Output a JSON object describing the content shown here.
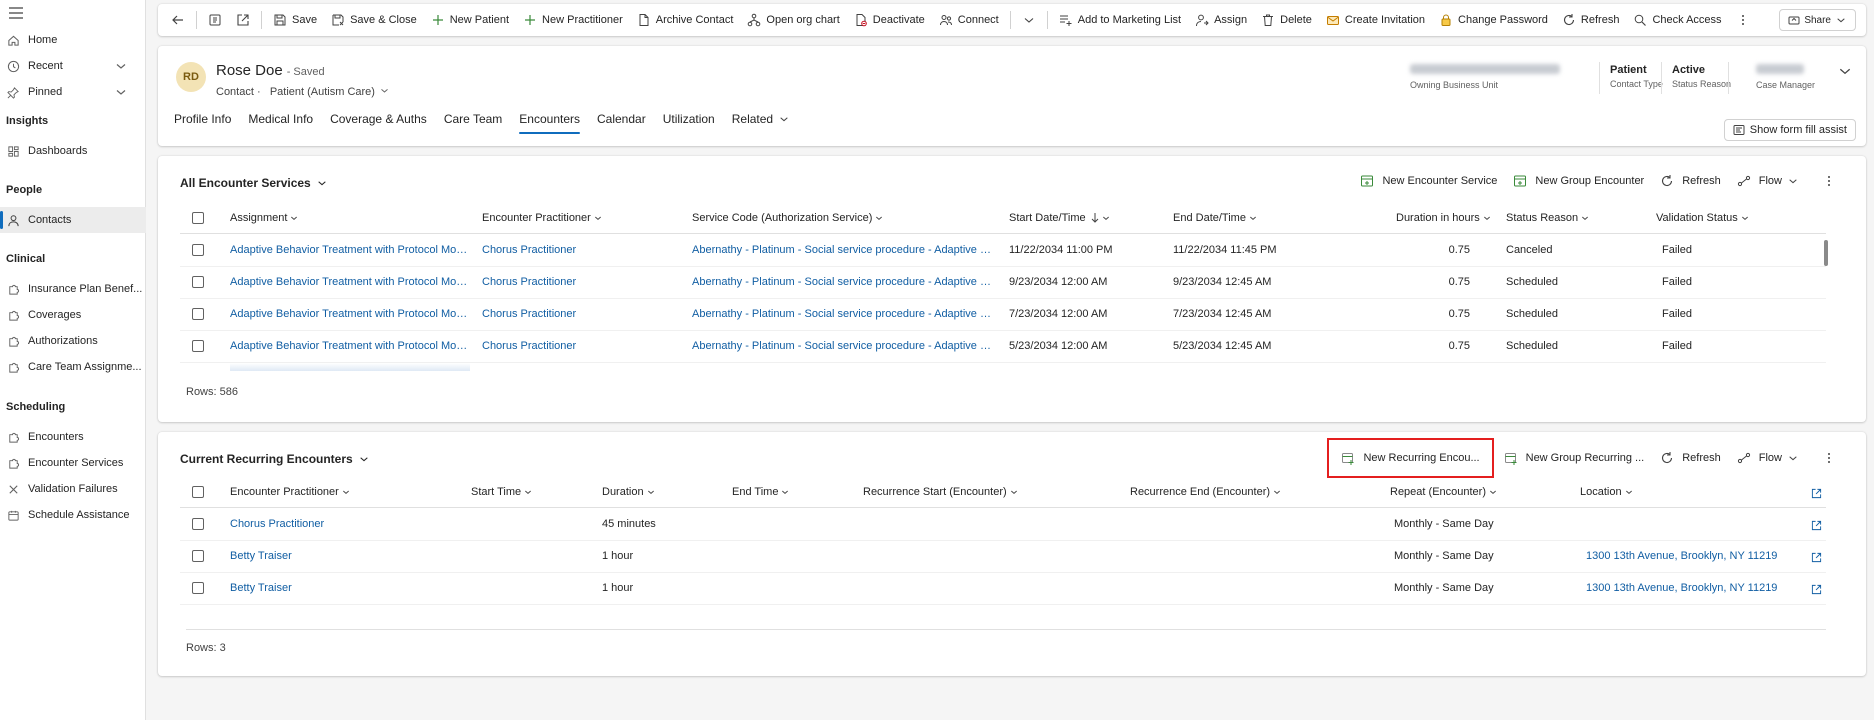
{
  "sidebar": {
    "items": [
      {
        "key": "home",
        "label": "Home",
        "icon": "home-icon"
      },
      {
        "key": "recent",
        "label": "Recent",
        "icon": "clock-icon"
      },
      {
        "key": "pinned",
        "label": "Pinned",
        "icon": "pin-icon"
      }
    ],
    "groups": {
      "insights": "Insights",
      "people": "People",
      "clinical": "Clinical",
      "scheduling": "Scheduling"
    },
    "insights_items": [
      "Dashboards"
    ],
    "people_items": [
      "Contacts"
    ],
    "clinical_items": [
      "Insurance Plan Benef...",
      "Coverages",
      "Authorizations",
      "Care Team Assignme..."
    ],
    "scheduling_items": [
      "Encounters",
      "Encounter Services",
      "Validation Failures",
      "Schedule Assistance"
    ]
  },
  "commandbar": {
    "save": "Save",
    "save_close": "Save & Close",
    "new_patient": "New Patient",
    "new_practitioner": "New Practitioner",
    "archive_contact": "Archive Contact",
    "open_org_chart": "Open org chart",
    "deactivate": "Deactivate",
    "connect": "Connect",
    "add_marketing": "Add to Marketing List",
    "assign": "Assign",
    "delete": "Delete",
    "create_invitation": "Create Invitation",
    "change_password": "Change Password",
    "refresh": "Refresh",
    "check_access": "Check Access",
    "share": "Share"
  },
  "record": {
    "initials": "RD",
    "name": "Rose Doe",
    "saved": "- Saved",
    "entity": "Contact",
    "form": "Patient (Autism Care)",
    "owning_bu_label": "Owning Business Unit",
    "contact_type_value": "Patient",
    "contact_type_label": "Contact Type",
    "status_value": "Active",
    "status_label": "Status Reason",
    "case_manager_label": "Case Manager"
  },
  "tabs": [
    "Profile Info",
    "Medical Info",
    "Coverage & Auths",
    "Care Team",
    "Encounters",
    "Calendar",
    "Utilization",
    "Related"
  ],
  "form_fill_assist": "Show form fill assist",
  "encounter_services": {
    "title": "All Encounter Services",
    "cmd_new_service": "New Encounter Service",
    "cmd_new_group": "New Group Encounter",
    "cmd_refresh": "Refresh",
    "cmd_flow": "Flow",
    "columns": [
      "Assignment",
      "Encounter Practitioner",
      "Service Code (Authorization Service)",
      "Start Date/Time",
      "End Date/Time",
      "Duration in hours",
      "Status Reason",
      "Validation Status"
    ],
    "rows": [
      {
        "assignment": "Adaptive Behavior Treatment with Protocol Mod...",
        "practitioner": "Chorus Practitioner",
        "service": "Abernathy - Platinum - Social service procedure - Adaptive Be...",
        "start": "11/22/2034 11:00 PM",
        "end": "11/22/2034 11:45 PM",
        "duration": "0.75",
        "status": "Canceled",
        "validation": "Failed"
      },
      {
        "assignment": "Adaptive Behavior Treatment with Protocol Mod...",
        "practitioner": "Chorus Practitioner",
        "service": "Abernathy - Platinum - Social service procedure - Adaptive Be...",
        "start": "9/23/2034 12:00 AM",
        "end": "9/23/2034 12:45 AM",
        "duration": "0.75",
        "status": "Scheduled",
        "validation": "Failed"
      },
      {
        "assignment": "Adaptive Behavior Treatment with Protocol Mod...",
        "practitioner": "Chorus Practitioner",
        "service": "Abernathy - Platinum - Social service procedure - Adaptive Be...",
        "start": "7/23/2034 12:00 AM",
        "end": "7/23/2034 12:45 AM",
        "duration": "0.75",
        "status": "Scheduled",
        "validation": "Failed"
      },
      {
        "assignment": "Adaptive Behavior Treatment with Protocol Mod...",
        "practitioner": "Chorus Practitioner",
        "service": "Abernathy - Platinum - Social service procedure - Adaptive Be...",
        "start": "5/23/2034 12:00 AM",
        "end": "5/23/2034 12:45 AM",
        "duration": "0.75",
        "status": "Scheduled",
        "validation": "Failed"
      }
    ],
    "rows_label": "Rows: 586"
  },
  "recurring": {
    "title": "Current Recurring Encounters",
    "cmd_new_recurring": "New Recurring Encou...",
    "cmd_new_group_recurring": "New Group Recurring ...",
    "cmd_refresh": "Refresh",
    "cmd_flow": "Flow",
    "columns": [
      "Encounter Practitioner",
      "Start Time",
      "Duration",
      "End Time",
      "Recurrence Start (Encounter)",
      "Recurrence End (Encounter)",
      "Repeat (Encounter)",
      "Location"
    ],
    "rows": [
      {
        "practitioner": "Chorus Practitioner",
        "start": "",
        "duration": "45 minutes",
        "end": "",
        "rec_start": "",
        "rec_end": "",
        "repeat": "Monthly - Same Day",
        "location": ""
      },
      {
        "practitioner": "Betty Traiser",
        "start": "",
        "duration": "1 hour",
        "end": "",
        "rec_start": "",
        "rec_end": "",
        "repeat": "Monthly - Same Day",
        "location": "1300 13th Avenue, Brooklyn, NY 11219"
      },
      {
        "practitioner": "Betty Traiser",
        "start": "",
        "duration": "1 hour",
        "end": "",
        "rec_start": "",
        "rec_end": "",
        "repeat": "Monthly - Same Day",
        "location": "1300 13th Avenue, Brooklyn, NY 11219"
      }
    ],
    "rows_label": "Rows: 3"
  },
  "colors": {
    "accent": "#0f6cbd",
    "link": "#115ea3",
    "highlight": "#e41f1f"
  }
}
